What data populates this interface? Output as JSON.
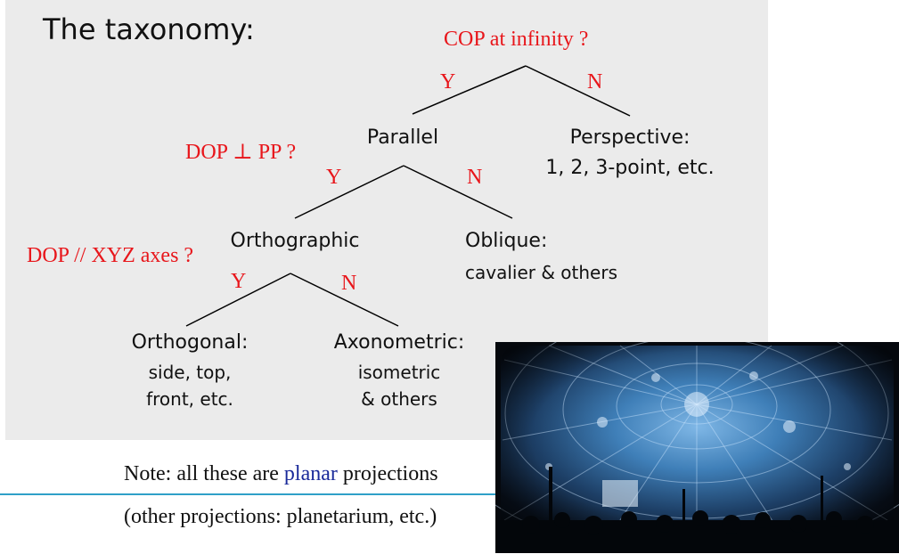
{
  "slide": {
    "title": "The taxonomy:",
    "accent_color": "#e8161b",
    "note_prefix": "Note: all these are ",
    "note_highlight": "planar",
    "note_suffix": " projections",
    "note_highlight_color": "#1a2a9a",
    "other_note": "(other projections: planetarium, etc.)",
    "rule_color": "#2fa0c8",
    "photo_icon": "planetarium-dome-photo"
  },
  "tree": {
    "q_root": "COP at infinity ?",
    "q_parallel": "DOP  ⊥ PP ?",
    "q_ortho": "DOP // XYZ axes ?",
    "y_label": "Y",
    "n_label": "N",
    "parallel": "Parallel",
    "perspective": "Perspective:",
    "perspective_sub": "1, 2, 3-point, etc.",
    "orthographic": "Orthographic",
    "oblique": "Oblique:",
    "oblique_sub": "cavalier & others",
    "orthogonal": "Orthogonal:",
    "orthogonal_sub1": "side, top,",
    "orthogonal_sub2": "front, etc.",
    "axonometric": "Axonometric:",
    "axonometric_sub1": "isometric",
    "axonometric_sub2": "& others"
  }
}
